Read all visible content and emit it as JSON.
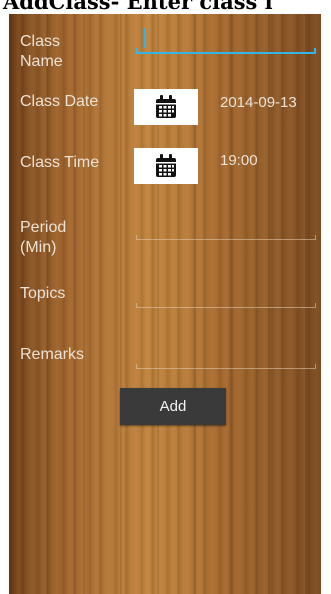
{
  "header": {
    "title": "AddClass- Enter class i"
  },
  "form": {
    "class_name_label": "Class\nName",
    "class_name_value": "",
    "class_date_label": "Class Date",
    "class_date_value": "2014-09-13",
    "class_time_label": "Class Time",
    "class_time_value": "19:00",
    "period_label": "Period\n(Min)",
    "period_value": "",
    "topics_label": "Topics",
    "topics_value": "",
    "remarks_label": "Remarks",
    "remarks_value": ""
  },
  "actions": {
    "add_label": "Add"
  },
  "icons": {
    "date_picker": "calendar-icon",
    "time_picker": "calendar-icon"
  },
  "colors": {
    "focus_accent": "#33b5e5",
    "button_bg": "#3a3a3a"
  }
}
